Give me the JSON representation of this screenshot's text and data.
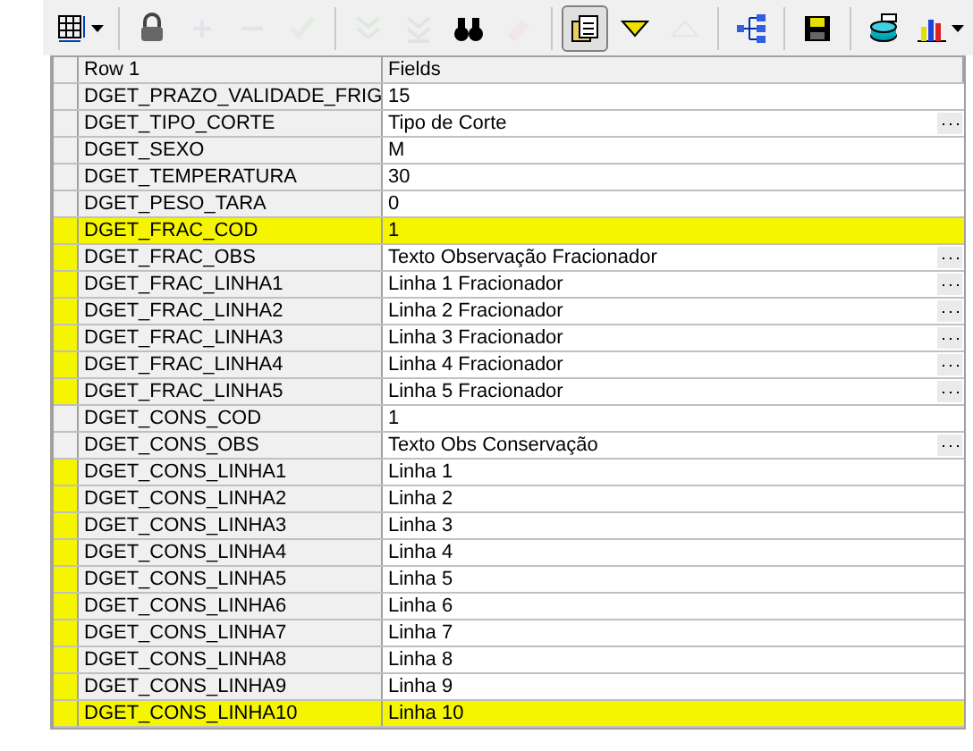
{
  "toolbar": [
    {
      "kind": "grid",
      "disabled": false,
      "pressed": false,
      "dropdown": true
    },
    {
      "kind": "lock",
      "disabled": false,
      "pressed": false
    },
    {
      "kind": "plus",
      "disabled": true,
      "pressed": false
    },
    {
      "kind": "minus",
      "disabled": true,
      "pressed": false
    },
    {
      "kind": "check",
      "disabled": true,
      "pressed": false
    },
    {
      "kind": "first",
      "disabled": true,
      "pressed": false
    },
    {
      "kind": "last",
      "disabled": true,
      "pressed": false
    },
    {
      "kind": "find",
      "disabled": false,
      "pressed": false
    },
    {
      "kind": "erase",
      "disabled": true,
      "pressed": false
    },
    {
      "kind": "notes",
      "disabled": false,
      "pressed": true
    },
    {
      "kind": "down",
      "disabled": false,
      "pressed": false
    },
    {
      "kind": "up",
      "disabled": true,
      "pressed": false
    },
    {
      "kind": "tree",
      "disabled": false,
      "pressed": false
    },
    {
      "kind": "save",
      "disabled": false,
      "pressed": false
    },
    {
      "kind": "database",
      "disabled": false,
      "pressed": false
    },
    {
      "kind": "chart",
      "disabled": false,
      "pressed": false,
      "dropdown": true
    }
  ],
  "table": {
    "columns": [
      "Row 1",
      "Fields"
    ],
    "rows": [
      {
        "name": "DGET_PRAZO_VALIDADE_FRIG",
        "value": "15",
        "ellipsis": false,
        "highlighted": false,
        "marked": false
      },
      {
        "name": "DGET_TIPO_CORTE",
        "value": "Tipo de Corte",
        "ellipsis": true,
        "highlighted": false,
        "marked": false
      },
      {
        "name": "DGET_SEXO",
        "value": "M",
        "ellipsis": false,
        "highlighted": false,
        "marked": false
      },
      {
        "name": "DGET_TEMPERATURA",
        "value": "30",
        "ellipsis": false,
        "highlighted": false,
        "marked": false
      },
      {
        "name": "DGET_PESO_TARA",
        "value": "0",
        "ellipsis": false,
        "highlighted": false,
        "marked": false
      },
      {
        "name": "DGET_FRAC_COD",
        "value": "1",
        "ellipsis": false,
        "highlighted": true,
        "marked": true
      },
      {
        "name": "DGET_FRAC_OBS",
        "value": "Texto Observação Fracionador",
        "ellipsis": true,
        "highlighted": false,
        "marked": true
      },
      {
        "name": "DGET_FRAC_LINHA1",
        "value": "Linha 1 Fracionador",
        "ellipsis": true,
        "highlighted": false,
        "marked": true
      },
      {
        "name": "DGET_FRAC_LINHA2",
        "value": "Linha 2 Fracionador",
        "ellipsis": true,
        "highlighted": false,
        "marked": true
      },
      {
        "name": "DGET_FRAC_LINHA3",
        "value": "Linha 3 Fracionador",
        "ellipsis": true,
        "highlighted": false,
        "marked": true
      },
      {
        "name": "DGET_FRAC_LINHA4",
        "value": "Linha 4 Fracionador",
        "ellipsis": true,
        "highlighted": false,
        "marked": true
      },
      {
        "name": "DGET_FRAC_LINHA5",
        "value": "Linha 5 Fracionador",
        "ellipsis": true,
        "highlighted": false,
        "marked": true
      },
      {
        "name": "DGET_CONS_COD",
        "value": "1",
        "ellipsis": false,
        "highlighted": false,
        "marked": false
      },
      {
        "name": "DGET_CONS_OBS",
        "value": "Texto Obs Conservação",
        "ellipsis": true,
        "highlighted": false,
        "marked": false
      },
      {
        "name": "DGET_CONS_LINHA1",
        "value": "Linha 1",
        "ellipsis": false,
        "highlighted": false,
        "marked": true
      },
      {
        "name": "DGET_CONS_LINHA2",
        "value": "Linha 2",
        "ellipsis": false,
        "highlighted": false,
        "marked": true
      },
      {
        "name": "DGET_CONS_LINHA3",
        "value": "Linha 3",
        "ellipsis": false,
        "highlighted": false,
        "marked": true
      },
      {
        "name": "DGET_CONS_LINHA4",
        "value": "Linha 4",
        "ellipsis": false,
        "highlighted": false,
        "marked": true
      },
      {
        "name": "DGET_CONS_LINHA5",
        "value": "Linha 5",
        "ellipsis": false,
        "highlighted": false,
        "marked": true
      },
      {
        "name": "DGET_CONS_LINHA6",
        "value": "Linha 6",
        "ellipsis": false,
        "highlighted": false,
        "marked": true
      },
      {
        "name": "DGET_CONS_LINHA7",
        "value": "Linha 7",
        "ellipsis": false,
        "highlighted": false,
        "marked": true
      },
      {
        "name": "DGET_CONS_LINHA8",
        "value": "Linha 8",
        "ellipsis": false,
        "highlighted": false,
        "marked": true
      },
      {
        "name": "DGET_CONS_LINHA9",
        "value": "Linha 9",
        "ellipsis": false,
        "highlighted": false,
        "marked": true
      },
      {
        "name": "DGET_CONS_LINHA10",
        "value": "Linha 10",
        "ellipsis": false,
        "highlighted": true,
        "marked": true
      }
    ]
  }
}
